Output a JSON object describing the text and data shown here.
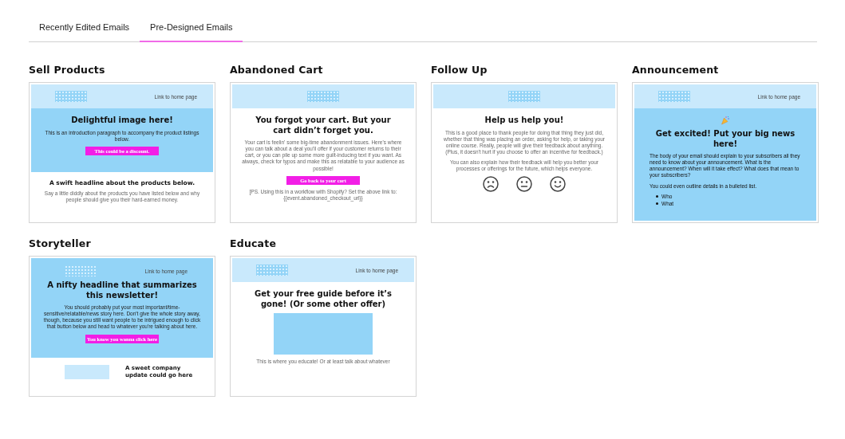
{
  "tabs": [
    {
      "label": "Recently Edited Emails",
      "selected": false
    },
    {
      "label": "Pre-Designed Emails",
      "selected": true
    }
  ],
  "templates": [
    {
      "title": "Sell Products",
      "sections": [
        {
          "kind": "pale",
          "items": [
            {
              "kind": "topbar",
              "link": "Link to home page"
            }
          ]
        },
        {
          "kind": "band",
          "items": [
            {
              "kind": "heading",
              "text": "Delightful image here!"
            },
            {
              "kind": "text",
              "text": "This is an introduction paragraph to accompany the product listings below."
            },
            {
              "kind": "button",
              "text": "This could be a discount."
            }
          ]
        },
        {
          "kind": "plain",
          "items": [
            {
              "kind": "subheading",
              "text": "A swift headline about the products below."
            },
            {
              "kind": "text",
              "text": "Say a little diddly about the products you have listed below and why people should give you their hard-earned money."
            }
          ]
        }
      ]
    },
    {
      "title": "Abandoned Cart",
      "sections": [
        {
          "kind": "pale",
          "items": [
            {
              "kind": "logo"
            }
          ]
        },
        {
          "kind": "plain",
          "items": [
            {
              "kind": "heading",
              "text": "You forgot your cart. But your cart didn’t forget you."
            },
            {
              "kind": "text",
              "text": "Your cart is feelin' some big-time abandonment issues. Here's where you can talk about a deal you'll offer if your customer returns to their cart, or you can pile up some more guilt-inducing text if you want. As always, check for typos and make this as relatable to your audience as possible!"
            },
            {
              "kind": "button",
              "text": "Go back to your cart"
            },
            {
              "kind": "note",
              "text": "[PS. Using this in a workflow with Shopify? Set the above link to: {{event.abandoned_checkout_url}}"
            }
          ]
        }
      ]
    },
    {
      "title": "Follow Up",
      "sections": [
        {
          "kind": "pale",
          "items": [
            {
              "kind": "logo"
            }
          ]
        },
        {
          "kind": "plain",
          "items": [
            {
              "kind": "heading",
              "text": "Help us help you!"
            },
            {
              "kind": "text",
              "text": "This is a good place to thank people for doing that thing they just did, whether that thing was placing an order, asking for help, or taking your online course. Really, people will give their feedback about anything. (Plus, it doesn't hurt if you choose to offer an incentive for feedback.)"
            },
            {
              "kind": "text",
              "text": "You can also explain how their feedback will help you better your processes or offerings for the future, which helps everyone."
            },
            {
              "kind": "faces"
            }
          ]
        }
      ]
    },
    {
      "title": "Announcement",
      "sections": [
        {
          "kind": "pale",
          "items": [
            {
              "kind": "topbar",
              "link": "Link to home page"
            }
          ]
        },
        {
          "kind": "band",
          "items": [
            {
              "kind": "emoji"
            },
            {
              "kind": "heading",
              "text": "Get excited! Put your big news here!"
            },
            {
              "kind": "body",
              "text": "The body of your email should explain to your subscribers all they need to know about your announcement. What is the announcement? When will it take effect? What does that mean to your subscribers?"
            },
            {
              "kind": "body",
              "text": "You could even outline details in a bulleted list."
            },
            {
              "kind": "list",
              "entries": [
                "Who",
                "What"
              ]
            }
          ]
        }
      ]
    },
    {
      "title": "Storyteller",
      "sections": [
        {
          "kind": "band",
          "items": [
            {
              "kind": "topbar",
              "link": "Link to home page"
            },
            {
              "kind": "heading",
              "text": "A nifty headline that summarizes this newsletter!"
            },
            {
              "kind": "text",
              "text": "You should probably put your most important/time-sensitive/relatable/news story here. Don't give the whole story away, though, because you still want people to be intrigued enough to click that button below and head to whatever you're talking about here."
            },
            {
              "kind": "button",
              "text": "You know you wanna click here"
            }
          ]
        },
        {
          "kind": "plain",
          "items": [
            {
              "kind": "split",
              "text": "A sweet company update could go here"
            }
          ]
        }
      ]
    },
    {
      "title": "Educate",
      "sections": [
        {
          "kind": "pale",
          "items": [
            {
              "kind": "topbar",
              "link": "Link to home page"
            }
          ]
        },
        {
          "kind": "plain",
          "items": [
            {
              "kind": "heading",
              "text": "Get your free guide before it’s gone! (Or some other offer)"
            },
            {
              "kind": "image"
            },
            {
              "kind": "text",
              "text": "This is where you educate! Or at least talk about whatever"
            }
          ]
        }
      ]
    }
  ]
}
